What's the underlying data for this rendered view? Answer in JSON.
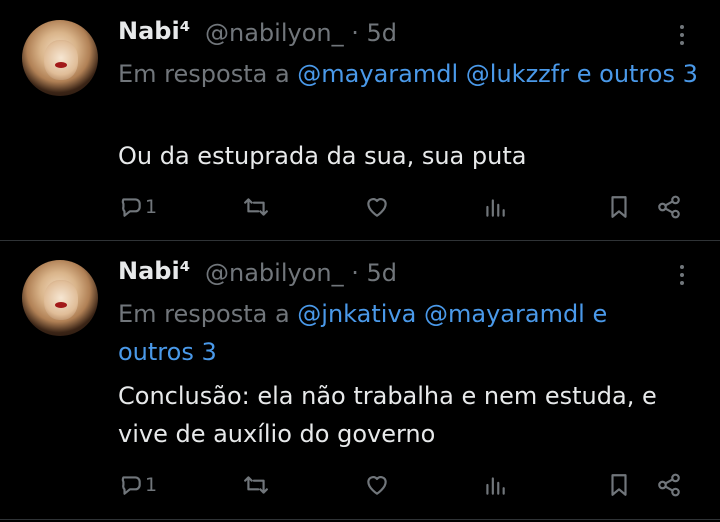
{
  "tweets": [
    {
      "name": "Nabi⁴",
      "handle": "@nabilyon_",
      "time": "5d",
      "reply_prefix": "Em resposta a",
      "mentions": [
        "@mayaramdl",
        "@lukzzfr"
      ],
      "reply_suffix": "e outros 3",
      "text": "Ou da estuprada da sua, sua puta",
      "reply_count": "1"
    },
    {
      "name": "Nabi⁴",
      "handle": "@nabilyon_",
      "time": "5d",
      "reply_prefix": "Em resposta a",
      "mentions": [
        "@jnkativa",
        "@mayaramdl"
      ],
      "reply_suffix": "e outros 3",
      "text": "Conclusão: ela não trabalha e nem estuda, e vive de auxílio do governo",
      "reply_count": "1"
    }
  ],
  "icons": {
    "more": "more-vertical-icon",
    "reply": "comment-icon",
    "retweet": "retweet-icon",
    "like": "heart-icon",
    "views": "bar-chart-icon",
    "bookmark": "bookmark-icon",
    "share": "share-icon"
  },
  "colors": {
    "background": "#000000",
    "text": "#e7e9ea",
    "muted": "#71767b",
    "link": "#4a99e9",
    "divider": "#2f3336"
  }
}
